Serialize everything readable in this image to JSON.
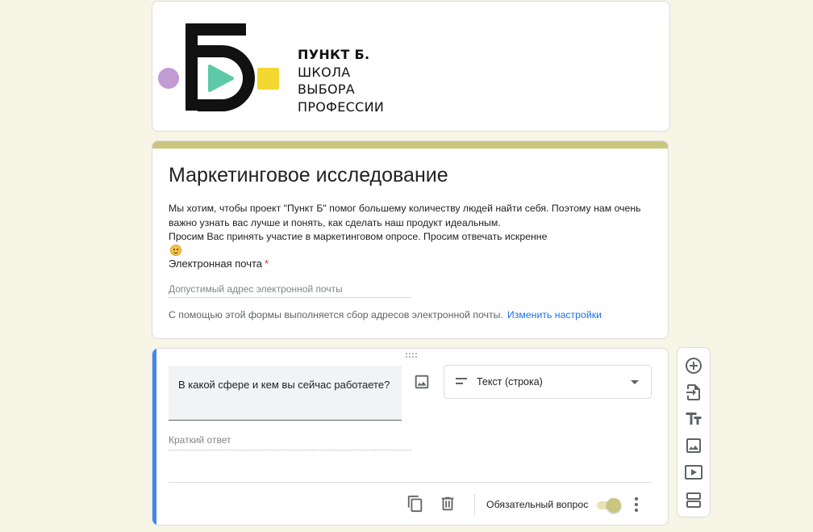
{
  "header": {
    "logo_letter": "Б",
    "logo_lines": [
      "ПУНКТ Б.",
      "ШКОЛА",
      "ВЫБОРА",
      "ПРОФЕССИИ"
    ]
  },
  "form": {
    "title": "Маркетинговое исследование",
    "description": [
      "Мы хотим, чтобы проект \"Пункт Б\" помог большему количеству людей найти себя. Поэтому нам очень",
      "важно узнать вас лучше и понять, как сделать наш продукт идеальным.",
      "Просим Вас принять участие в маркетинговом опросе. Просим отвечать искренне"
    ],
    "email_label": "Электронная почта",
    "required_mark": "*",
    "email_placeholder": "Допустимый адрес электронной почты",
    "collect_note": "С помощью этой формы выполняется сбор адресов электронной почты.",
    "change_settings_link": "Изменить настройки"
  },
  "question": {
    "text": "В какой сфере и кем вы сейчас работаете?",
    "type_label": "Текст (строка)",
    "short_answer_placeholder": "Краткий ответ",
    "required_label": "Обязательный вопрос",
    "required_on": true
  },
  "colors": {
    "theme_accent": "#c9c67e",
    "question_accent": "#4285f4",
    "logo_purple": "#c39bd3",
    "logo_teal": "#5ec9a6",
    "logo_yellow": "#f2d831"
  },
  "icons": {
    "toolbar": [
      "add-question-icon",
      "import-questions-icon",
      "add-title-icon",
      "add-image-icon",
      "add-video-icon",
      "add-section-icon"
    ],
    "question_footer": [
      "duplicate-icon",
      "delete-icon",
      "more-vert-icon"
    ]
  }
}
